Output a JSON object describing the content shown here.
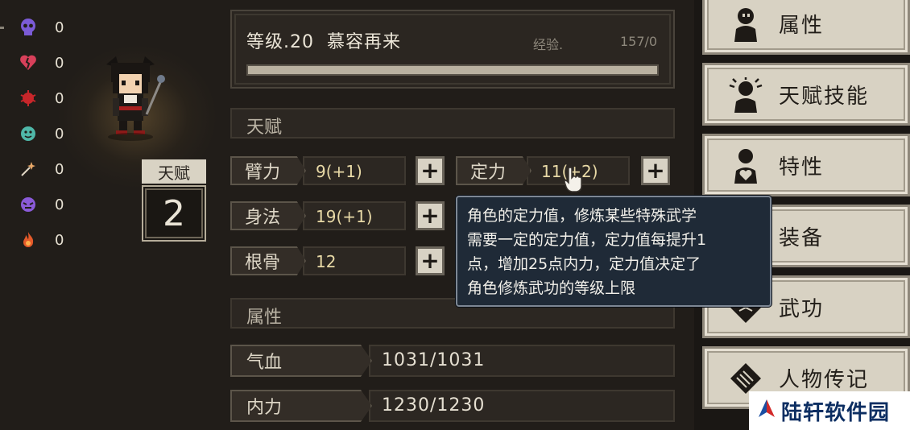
{
  "status_effects": [
    {
      "icon": "purple-skull-icon",
      "color": "#7b5bd6",
      "value": "0"
    },
    {
      "icon": "broken-heart-icon",
      "color": "#d8405a",
      "value": "0"
    },
    {
      "icon": "red-bug-icon",
      "color": "#c8262a",
      "value": "0"
    },
    {
      "icon": "teal-face-icon",
      "color": "#4fb7a8",
      "value": "0"
    },
    {
      "icon": "sparkle-wand-icon",
      "color": "#e8a868",
      "value": "0"
    },
    {
      "icon": "purple-mask-icon",
      "color": "#8a5ad8",
      "value": "0"
    },
    {
      "icon": "fire-icon",
      "color": "#e45a2a",
      "value": "0"
    }
  ],
  "talent_points": {
    "label": "天赋",
    "value": "2"
  },
  "header": {
    "level": "等级.20",
    "name": "慕容再来",
    "exp_label": "经验.",
    "exp_value": "157/0",
    "exp_progress": 1.0
  },
  "talent_section": {
    "title": "天赋",
    "stats": [
      {
        "label": "臂力",
        "value": "9(+1)"
      },
      {
        "label": "身法",
        "value": "19(+1)"
      },
      {
        "label": "根骨",
        "value": "12"
      },
      {
        "label": "定力",
        "value": "11(+2)"
      }
    ],
    "plus_label": "+"
  },
  "attribute_section": {
    "title": "属性",
    "items": [
      {
        "label": "气血",
        "value": "1031/1031"
      },
      {
        "label": "内力",
        "value": "1230/1230"
      }
    ]
  },
  "tooltip": {
    "lines": [
      "角色的定力值，修炼某些特殊武学",
      "需要一定的定力值，定力值每提升1",
      "点，增加25点内力，定力值决定了",
      "角色修炼武功的等级上限"
    ]
  },
  "tabs": [
    {
      "label": "属性",
      "icon": "person-icon"
    },
    {
      "label": "天赋技能",
      "icon": "person-glow-icon"
    },
    {
      "label": "特性",
      "icon": "person-heart-icon"
    },
    {
      "label": "装备",
      "icon": "armor-icon"
    },
    {
      "label": "武功",
      "icon": "book-icon"
    },
    {
      "label": "人物传记",
      "icon": "scroll-icon"
    }
  ],
  "watermark": {
    "text": "陆轩软件园"
  },
  "colors": {
    "background": "#211d19",
    "panel": "#2b2621",
    "tab": "#d8d2c3",
    "tooltip": "#1f2a37",
    "stat_value": "#e8d9a6"
  }
}
